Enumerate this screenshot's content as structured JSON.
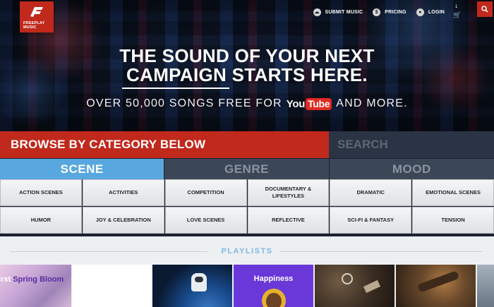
{
  "brand": {
    "logo_line1": "FREEPLAY",
    "logo_line2": "MUSIC",
    "accent": "#c0291c"
  },
  "nav": {
    "submit": {
      "label": "SUBMIT MUSIC",
      "icon": "upload-cloud-icon"
    },
    "pricing": {
      "label": "PRICING",
      "icon": "dollar-icon"
    },
    "login": {
      "label": "LOGIN",
      "icon": "user-icon"
    },
    "cart_count": "1",
    "cart_icon": "cart-icon",
    "search_icon": "search-icon"
  },
  "hero": {
    "headline_line1": "THE SOUND OF YOUR NEXT",
    "headline_line2": "CAMPAIGN STARTS HERE.",
    "sub_before": "OVER 50,000 SONGS FREE FOR",
    "yt_you": "You",
    "yt_tube": "Tube",
    "sub_after": "AND MORE."
  },
  "browse": {
    "title": "BROWSE BY CATEGORY BELOW",
    "search_placeholder": "SEARCH"
  },
  "tabs": [
    {
      "label": "SCENE",
      "active": true
    },
    {
      "label": "GENRE",
      "active": false
    },
    {
      "label": "MOOD",
      "active": false
    }
  ],
  "categories": [
    "ACTION SCENES",
    "ACTIVITIES",
    "COMPETITION",
    "DOCUMENTARY & LIFESTYLES",
    "DRAMATIC",
    "EMOTIONAL SCENES",
    "HUMOR",
    "JOY & CELEBRATION",
    "LOVE SCENES",
    "REFLECTIVE",
    "SCI-FI & FANTASY",
    "TENSION"
  ],
  "playlists": {
    "title": "PLAYLISTS",
    "tiles": [
      {
        "label_pre": "irst ",
        "label": "Spring Bloom"
      },
      {
        "label": ""
      },
      {
        "label": ""
      },
      {
        "label": "Happiness"
      },
      {
        "label": ""
      },
      {
        "label": ""
      },
      {
        "label": ""
      }
    ]
  }
}
